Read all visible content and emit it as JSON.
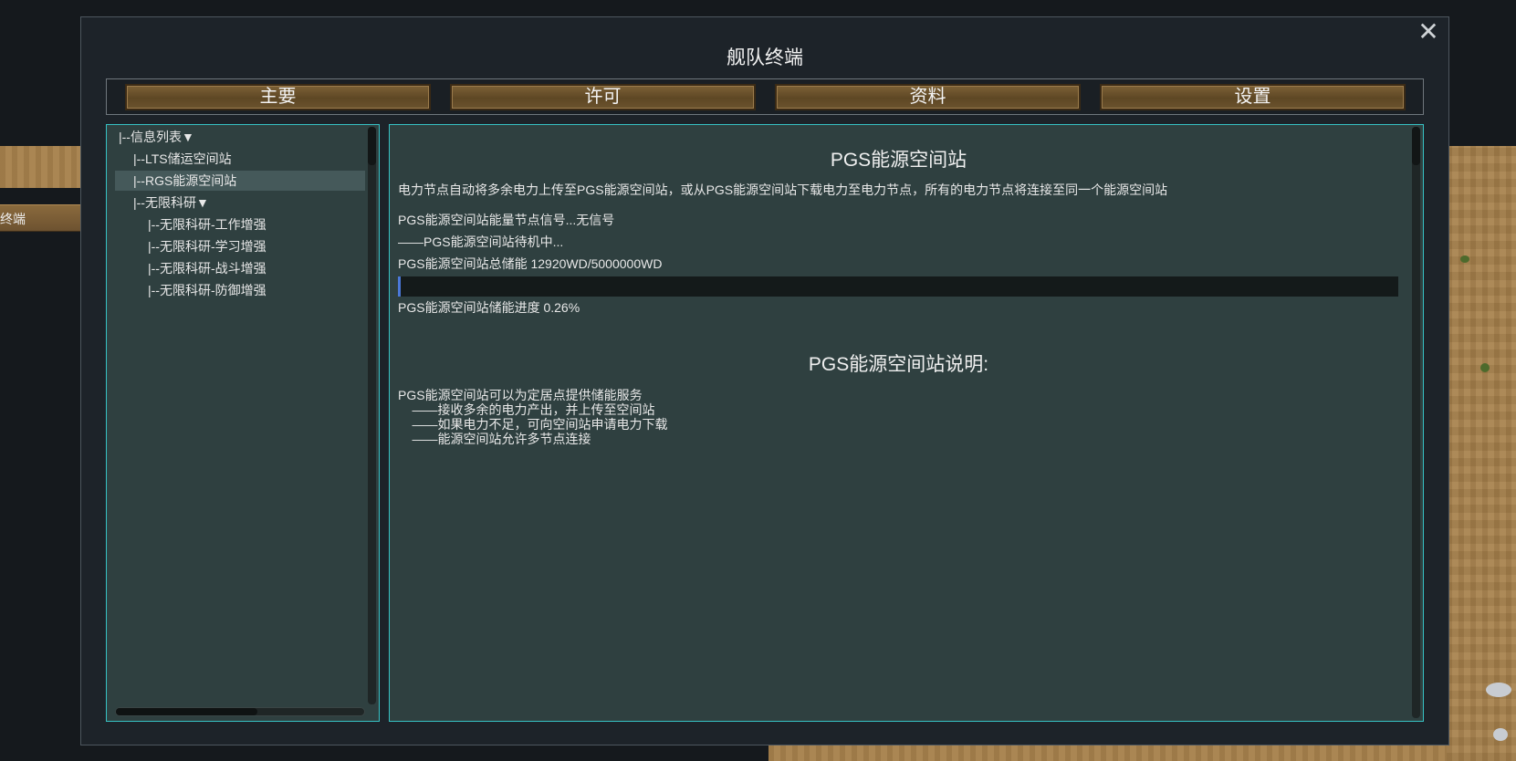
{
  "window": {
    "title": "舰队终端",
    "close_label": "✕"
  },
  "background": {
    "tab_label": "终端"
  },
  "tabs": [
    {
      "label": "主要"
    },
    {
      "label": "许可"
    },
    {
      "label": "资料"
    },
    {
      "label": "设置"
    }
  ],
  "tree": {
    "items": [
      {
        "label": "|--信息列表▼",
        "indent": 0
      },
      {
        "label": "|--LTS储运空间站",
        "indent": 1
      },
      {
        "label": "|--RGS能源空间站",
        "indent": 1,
        "selected": true
      },
      {
        "label": "|--无限科研▼",
        "indent": 1
      },
      {
        "label": "|--无限科研-工作增强",
        "indent": 2
      },
      {
        "label": "|--无限科研-学习增强",
        "indent": 2
      },
      {
        "label": "|--无限科研-战斗增强",
        "indent": 2
      },
      {
        "label": "|--无限科研-防御增强",
        "indent": 2
      }
    ]
  },
  "detail": {
    "title": "PGS能源空间站",
    "description": "电力节点自动将多余电力上传至PGS能源空间站，或从PGS能源空间站下载电力至电力节点，所有的电力节点将连接至同一个能源空间站",
    "signal": "PGS能源空间站能量节点信号...无信号",
    "status": "——PGS能源空间站待机中...",
    "storage": "PGS能源空间站总储能 12920WD/5000000WD",
    "progress_fraction": 0.0026,
    "progress_text": "PGS能源空间站储能进度 0.26%",
    "explain_title": "PGS能源空间站说明:",
    "explain_lines": [
      "PGS能源空间站可以为定居点提供储能服务",
      "    ——接收多余的电力产出，并上传至空间站",
      "    ——如果电力不足，可向空间站申请电力下载",
      "    ——能源空间站允许多节点连接"
    ]
  },
  "colors": {
    "panel_bg": "#2f4040",
    "panel_border": "#36c2c4",
    "progress_fill": "#4b78d8",
    "tab_button": "#6b532e"
  }
}
